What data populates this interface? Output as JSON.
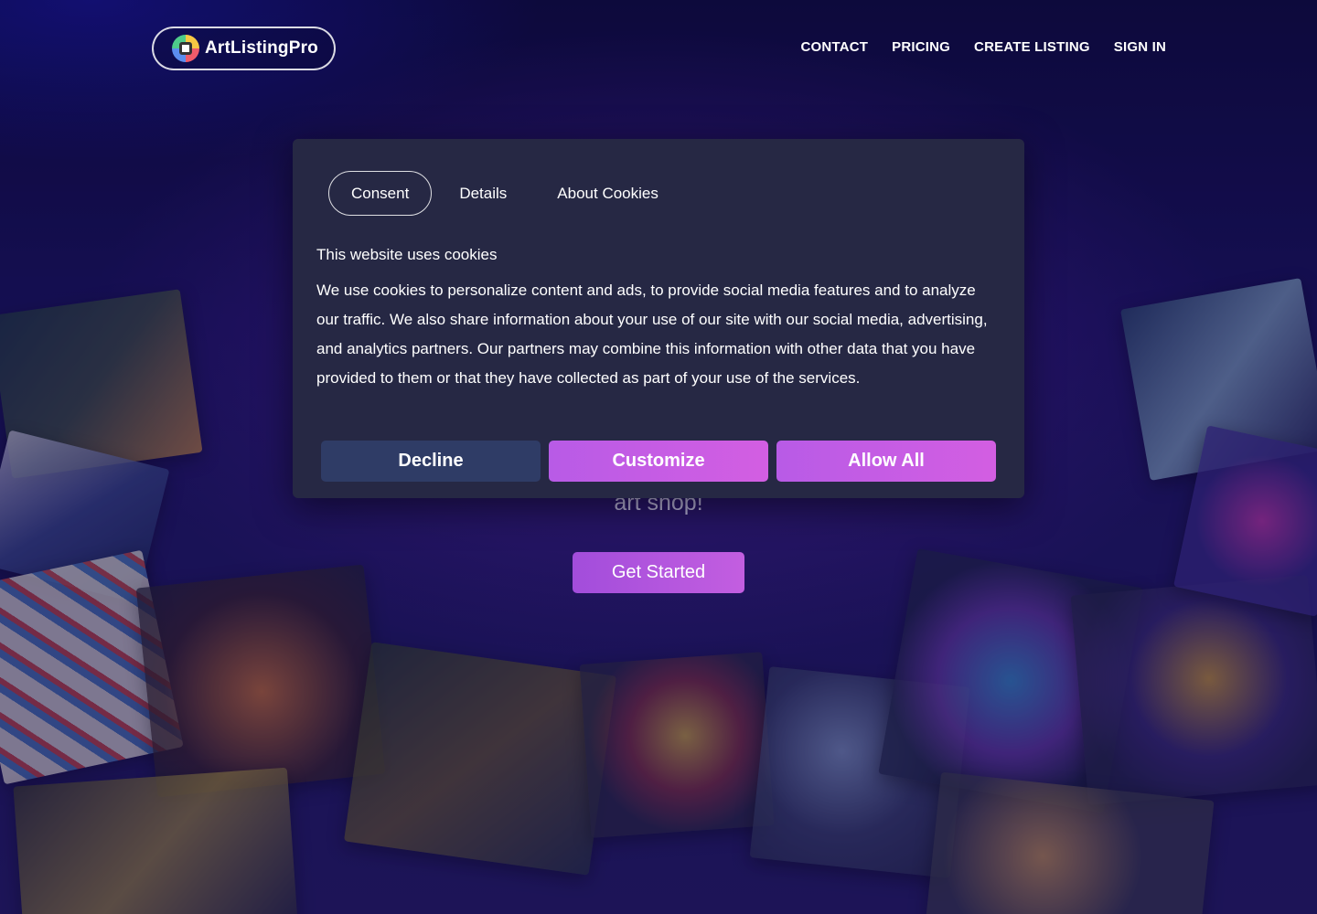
{
  "brand": {
    "name": "ArtListingPro",
    "logo_icon": "artlistingpro-logo-icon"
  },
  "nav": {
    "items": [
      {
        "label": "CONTACT"
      },
      {
        "label": "PRICING"
      },
      {
        "label": "CREATE LISTING"
      },
      {
        "label": "SIGN IN"
      }
    ]
  },
  "hero": {
    "subtitle_visible": "art shop!",
    "cta_label": "Get Started"
  },
  "cookie_modal": {
    "tabs": [
      {
        "label": "Consent",
        "active": true
      },
      {
        "label": "Details",
        "active": false
      },
      {
        "label": "About Cookies",
        "active": false
      }
    ],
    "title": "This website uses cookies",
    "body": "We use cookies to personalize content and ads, to provide social media features and to analyze our traffic. We also share information about your use of our site with our social media, advertising, and analytics partners. Our partners may combine this information with other data that you have provided to them or that they have collected as part of your use of the services.",
    "buttons": {
      "decline": "Decline",
      "customize": "Customize",
      "allow_all": "Allow All"
    }
  },
  "colors": {
    "background": "#0d0a3a",
    "modal": "#262844",
    "decline_button": "#2f3c66",
    "accent_gradient_start": "#b85be6",
    "accent_gradient_end": "#d35ee2"
  }
}
